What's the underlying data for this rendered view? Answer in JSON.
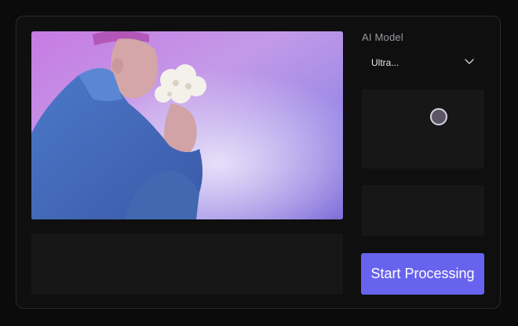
{
  "sidebar": {
    "ai_model_label": "AI Model",
    "dropdown_value": "Ultra..."
  },
  "actions": {
    "start_label": "Start Processing"
  },
  "icons": {
    "chevron": "chevron-down-icon"
  },
  "colors": {
    "accent": "#6763ee",
    "panel_bg": "#0f0f10",
    "box_bg": "#171718"
  }
}
